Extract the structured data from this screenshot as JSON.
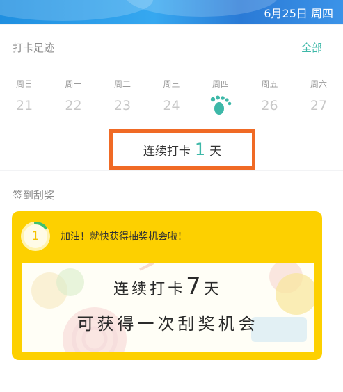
{
  "status_bar": {
    "date": "6月25日 周四"
  },
  "checkin": {
    "title": "打卡足迹",
    "all_link": "全部",
    "days": [
      {
        "weekday": "周日",
        "date": "21"
      },
      {
        "weekday": "周一",
        "date": "22"
      },
      {
        "weekday": "周二",
        "date": "23"
      },
      {
        "weekday": "周三",
        "date": "24"
      },
      {
        "weekday": "周四",
        "date": "",
        "icon": "footprint-icon"
      },
      {
        "weekday": "周五",
        "date": "26"
      },
      {
        "weekday": "周六",
        "date": "27"
      }
    ],
    "streak_prefix": "连续打卡",
    "streak_count": "1",
    "streak_suffix": "天"
  },
  "lottery": {
    "title": "签到刮奖",
    "progress_count": "1",
    "progress_fraction": 0.142857,
    "cheer_text": "加油！就快获得抽奖机会啦！",
    "ticket_line1_prefix": "连续打卡",
    "ticket_line1_number": "7",
    "ticket_line1_suffix": "天",
    "ticket_line2": "可获得一次刮奖机会"
  },
  "colors": {
    "accent_teal": "#3db8a8",
    "highlight_orange": "#f06a25",
    "card_yellow": "#fdd000",
    "progress_green": "#3fc16b"
  }
}
